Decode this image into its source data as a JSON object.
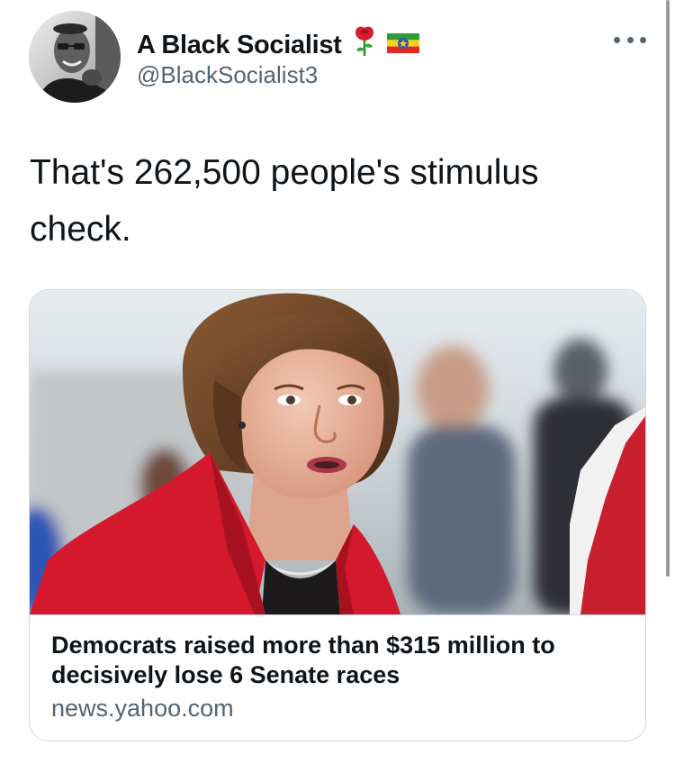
{
  "author": {
    "display_name": "A Black Socialist",
    "handle": "@BlackSocialist3",
    "avatar": "profile-photo",
    "badges": [
      "rose-emoji",
      "ethiopia-flag-emoji"
    ]
  },
  "tweet": {
    "text": "That's 262,500 people's stimulus check."
  },
  "link_card": {
    "title": "Democrats raised more than $315 million to decisively lose 6 Senate races",
    "domain": "news.yahoo.com",
    "image": "photo-of-woman-in-red-blazer"
  },
  "menu": {
    "icon": "more-options-icon"
  },
  "colors": {
    "text_primary": "#0f1419",
    "text_secondary": "#536471",
    "border": "#cfd9de",
    "rose_red": "#d81e2a",
    "blazer_red": "#d3192b"
  }
}
